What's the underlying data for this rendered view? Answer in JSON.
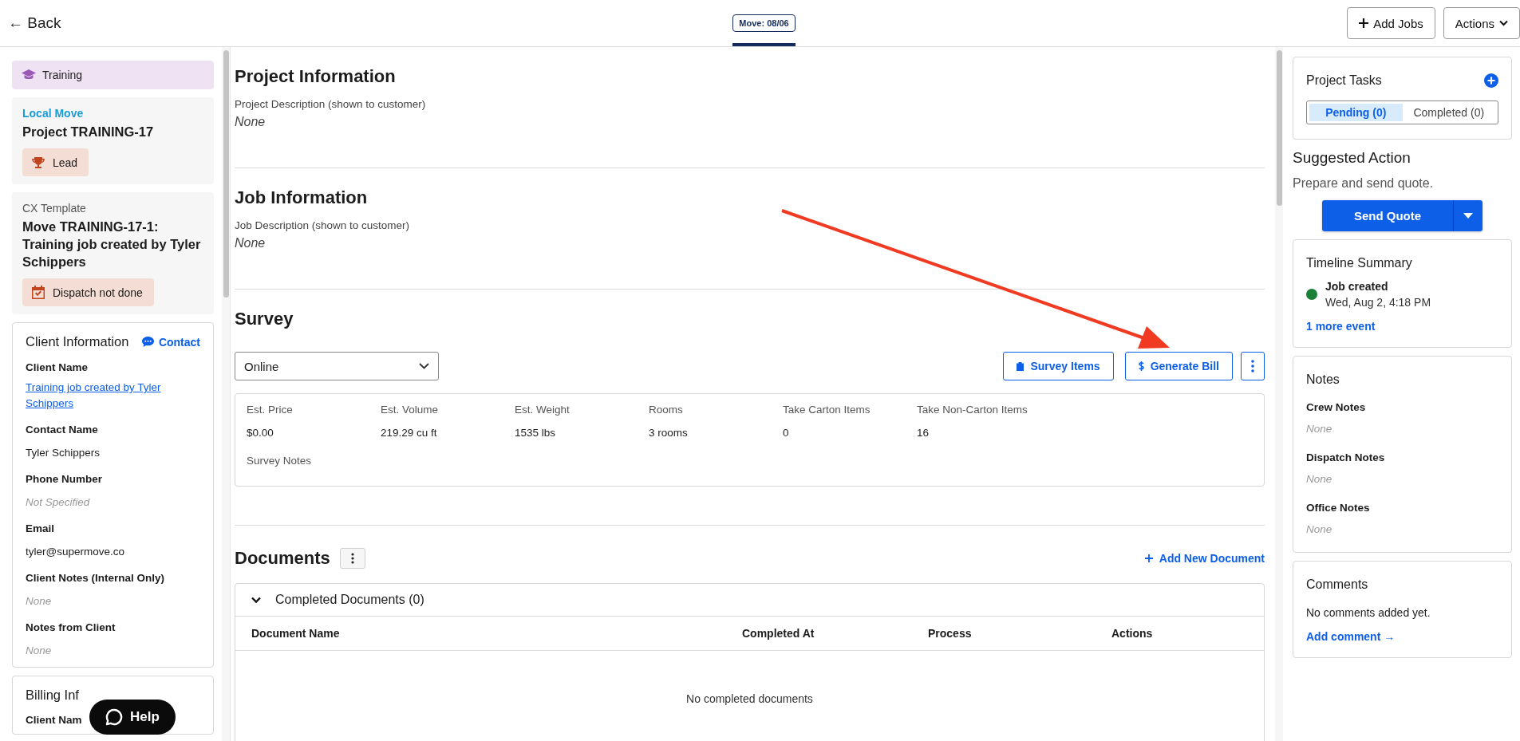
{
  "header": {
    "back": "← Back",
    "tabs": [
      {
        "label": "Move: 08/06",
        "selected": true
      }
    ],
    "buttons": [
      {
        "label": "Add Jobs",
        "kind": "add"
      },
      {
        "label": "Actions",
        "kind": "menu"
      }
    ]
  },
  "sidebar": {
    "badge": "Training",
    "project": {
      "type": "Local Move",
      "title": "Project TRAINING-17",
      "status": "Lead"
    },
    "job": {
      "template": "CX Template",
      "title": "Move TRAINING-17-1: Training job created by Tyler Schippers",
      "status": "Dispatch not done"
    },
    "client": {
      "title": "Client Information",
      "contact": "Contact",
      "fields": [
        {
          "label": "Client Name",
          "value": "Training job created by Tyler Schippers",
          "kind": "link"
        },
        {
          "label": "Contact Name",
          "value": "Tyler Schippers",
          "kind": "text"
        },
        {
          "label": "Phone Number",
          "value": "Not Specified",
          "kind": "empty"
        },
        {
          "label": "Email",
          "value": "tyler@supermove.co",
          "kind": "text"
        },
        {
          "label": "Client Notes (Internal Only)",
          "value": "None",
          "kind": "empty"
        },
        {
          "label": "Notes from Client",
          "value": "None",
          "kind": "empty"
        }
      ]
    },
    "billing": {
      "title": "Billing Inf",
      "field": "Client Nam"
    }
  },
  "help": "Help",
  "main": {
    "sections": [
      {
        "title": "Project Information",
        "label": "Project Description (shown to customer)",
        "value": "None"
      },
      {
        "title": "Job Information",
        "label": "Job Description (shown to customer)",
        "value": "None"
      }
    ],
    "survey": {
      "title": "Survey",
      "select": "Online",
      "buttons": [
        {
          "label": "Survey Items",
          "kind": "clipboard"
        },
        {
          "label": "Generate Bill",
          "kind": "dollar"
        }
      ],
      "stats": [
        {
          "label": "Est. Price",
          "value": "$0.00"
        },
        {
          "label": "Est. Volume",
          "value": "219.29 cu ft"
        },
        {
          "label": "Est. Weight",
          "value": "1535  lbs"
        },
        {
          "label": "Rooms",
          "value": "3 rooms"
        },
        {
          "label": "Take Carton Items",
          "value": "0"
        },
        {
          "label": "Take Non-Carton Items",
          "value": "16"
        }
      ],
      "notes_label": "Survey Notes"
    },
    "documents": {
      "title": "Documents",
      "add": "Add New Document",
      "panel": {
        "title": "Completed Documents (0)",
        "expanded": true,
        "columns": [
          "Document Name",
          "Completed At",
          "Process",
          "Actions"
        ],
        "empty": "No completed documents"
      }
    }
  },
  "right": {
    "tasks": {
      "title": "Project Tasks",
      "tabs": [
        {
          "label": "Pending (0)",
          "selected": true
        },
        {
          "label": "Completed (0)",
          "selected": false
        }
      ]
    },
    "suggested": {
      "title": "Suggested Action",
      "text": "Prepare and send quote.",
      "button": "Send Quote"
    },
    "timeline": {
      "title": "Timeline Summary",
      "events": [
        {
          "title": "Job created",
          "time": "Wed, Aug 2, 4:18 PM",
          "color": "#1a7f37"
        }
      ],
      "more": "1 more event"
    },
    "notes": {
      "title": "Notes",
      "items": [
        {
          "label": "Crew Notes",
          "value": "None"
        },
        {
          "label": "Dispatch Notes",
          "value": "None"
        },
        {
          "label": "Office Notes",
          "value": "None"
        }
      ]
    },
    "comments": {
      "title": "Comments",
      "text": "No comments added yet.",
      "link": "Add comment →"
    }
  }
}
